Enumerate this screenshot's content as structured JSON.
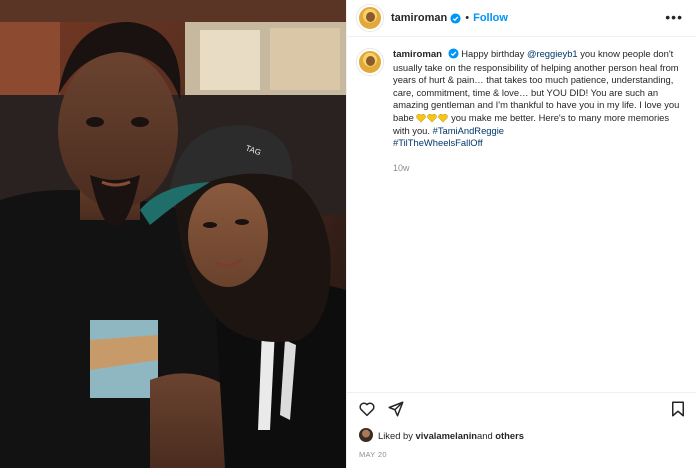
{
  "post": {
    "username": "tamiroman",
    "follow_label": "Follow",
    "separator": "•",
    "more_label": "•••",
    "caption": {
      "username": "tamiroman",
      "text_1": "Happy birthday ",
      "mention": "@reggieyb1",
      "text_2": " you know people don't usually take on the responsibility of helping another person heal from years of hurt & pain… that takes too much patience, understanding, care, commitment, time & love… but YOU DID! You are such an amazing gentleman and I'm thankful to have you in my life. I love you babe ",
      "text_3": " you make me better. Here's to many more memories with you. ",
      "hashtag_1": "#TamiAndReggie",
      "hashtag_2": "#TilTheWheelsFallOff",
      "time_ago": "10w"
    },
    "likes": {
      "prefix": "Liked by ",
      "user": "vivalamelanin",
      "middle": " and ",
      "others": "others"
    },
    "date": "MAY 20"
  },
  "colors": {
    "follow": "#0095f6",
    "link": "#00376b",
    "muted": "#8e8e8e",
    "heart": "#f5c518"
  },
  "icons": [
    "verified-icon",
    "more-options-icon",
    "heart-icon",
    "share-icon",
    "bookmark-icon",
    "yellow-heart-icon"
  ]
}
